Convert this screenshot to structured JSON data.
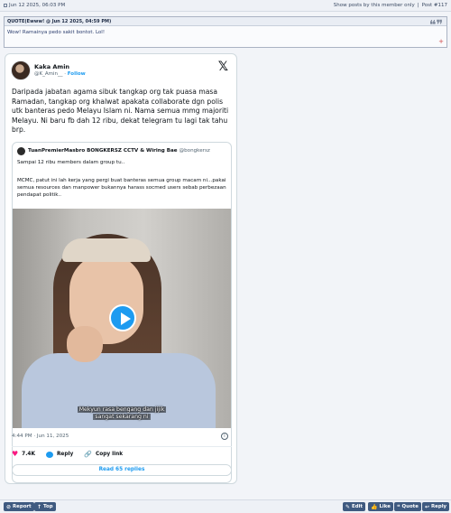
{
  "post_header": {
    "date": "Jun 12 2025, 06:03 PM",
    "show_posts_label": "Show posts by this member only",
    "separator": "|",
    "post_number": "Post #117"
  },
  "quote": {
    "header": "QUOTE(Ewww! @ Jun 12 2025, 04:59 PM)",
    "body": "Wow! Ramainya pedo sakit bontot. Lol!"
  },
  "tweet": {
    "author_name": "Kaka Amin",
    "author_handle": "@K_Amin__",
    "follow_label": "Follow",
    "text": "Daripada jabatan agama sibuk tangkap org tak puasa masa Ramadan, tangkap org khalwat apakata collaborate dgn polis utk banteras pedo Melayu Islam ni. Nama semua mmg majoriti Melayu. Ni baru fb dah 12 ribu, dekat telegram tu lagi tak tahu brp.",
    "quoted": {
      "name": "TuanPremierMasbro BONGKERSZ CCTV & Wiring Bae",
      "handle": "@bongkersz",
      "line1": "Sampai 12 ribu members dalam group tu..",
      "line2": "MCMC, patut ini lah kerja yang pergi buat banteras semua group macam ni...pakai semua resources dan manpower bukannya harass socmed users sebab perbezaan pendapat politik..",
      "video_caption_1": "Mekyun rasa bengang dan jijik",
      "video_caption_2": "sangat sekarang ni"
    },
    "timestamp": "4:44 PM · Jun 11, 2025",
    "likes": "7.4K",
    "reply_label": "Reply",
    "copy_link_label": "Copy link",
    "read_replies_label": "Read 65 replies"
  },
  "bottom_buttons": {
    "report": "Report",
    "top": "Top",
    "edit": "Edit",
    "like": "Like",
    "quote": "Quote",
    "reply": "Reply"
  },
  "colors": {
    "accent": "#1d9bf0",
    "like": "#f91880",
    "forum_button": "#3f5a80"
  }
}
